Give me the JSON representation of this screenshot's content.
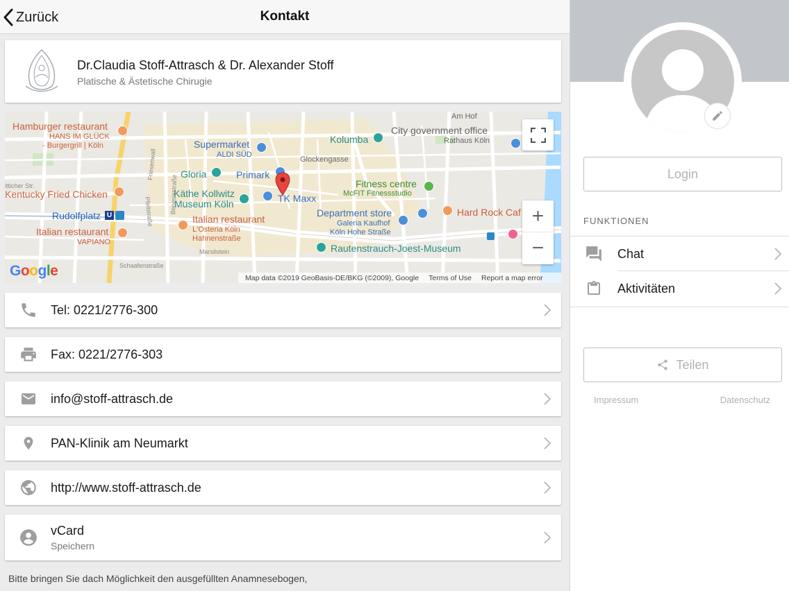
{
  "nav": {
    "back_label": "Zurück",
    "title": "Kontakt"
  },
  "header": {
    "name": "Dr.Claudia Stoff-Attrasch & Dr. Alexander Stoff",
    "subtitle": "Platische & Ästetische Chirugie"
  },
  "map": {
    "labels": {
      "hamburger": "Hamburger restaurant",
      "hans": "HANS IM GLÜCK",
      "burgergrill": "- Burgergrill | Köln",
      "supermarket": "Supermarket",
      "aldi": "ALDI SÜD",
      "city_gov": "City government office",
      "rathaus": "Rathaus Köln",
      "kolumba": "Kolumba",
      "gloria": "Gloria",
      "primark": "Primark",
      "glockengasse": "Glockengasse",
      "fitness": "Fitness centre",
      "mcfit": "McFIT Fitnessstudio",
      "kfc": "Kentucky Fried Chicken",
      "kaethe1": "Käthe Kollwitz",
      "kaethe2": "Museum Köln",
      "tkmaxx": "TK Maxx",
      "rudolfplatz": "Rudolfplatz",
      "dept_store": "Department store",
      "galeria": "Galeria Kaufhof",
      "galeria2": "Köln Hohe Straße",
      "hardrock": "Hard Rock Caf",
      "italian1": "Italian restaurant",
      "osteria1": "L'Osteria Köln",
      "osteria2": "Hahnenstraße",
      "italian2": "Italian restaurant",
      "vapiano": "VAPIANO",
      "rautenstrauch": "Rautenstrauch-Joest-Museum",
      "schaafen": "Schaafenstraße",
      "marsil": "Marsilstein",
      "friesenwall": "Friesenwall",
      "pfeilstr": "Pfeilstraße",
      "benesis": "Benesisstraße",
      "amhof": "Am Hof",
      "richer": "itticher Str."
    },
    "zoom_in": "+",
    "zoom_out": "−",
    "google": [
      "G",
      "o",
      "o",
      "g",
      "l",
      "e"
    ],
    "attribution": "Map data ©2019 GeoBasis-DE/BKG (©2009), Google",
    "terms": "Terms of Use",
    "report": "Report a map error"
  },
  "contacts": {
    "phone": "Tel: 0221/2776-300",
    "fax": "Fax: 0221/2776-303",
    "email": "info@stoff-attrasch.de",
    "location": "PAN-Klinik am Neumarkt",
    "web": "http://www.stoff-attrasch.de",
    "vcard": "vCard",
    "vcard_sub": "Speichern"
  },
  "note": "Bitte bringen Sie dach Möglichkeit den ausgefüllten Anamnesebogen,",
  "sidebar": {
    "login": "Login",
    "functions_header": "FUNKTIONEN",
    "chat": "Chat",
    "activities": "Aktivitäten",
    "share": "Teilen",
    "impressum": "Impressum",
    "privacy": "Datenschutz"
  },
  "colors": {
    "accent_text": "#1a1a1a",
    "map_orange": "#c8603b",
    "map_blue": "#3a6fb8",
    "map_teal": "#2b8c86",
    "map_green": "#3f8c34",
    "pin_red": "#e8453c"
  }
}
